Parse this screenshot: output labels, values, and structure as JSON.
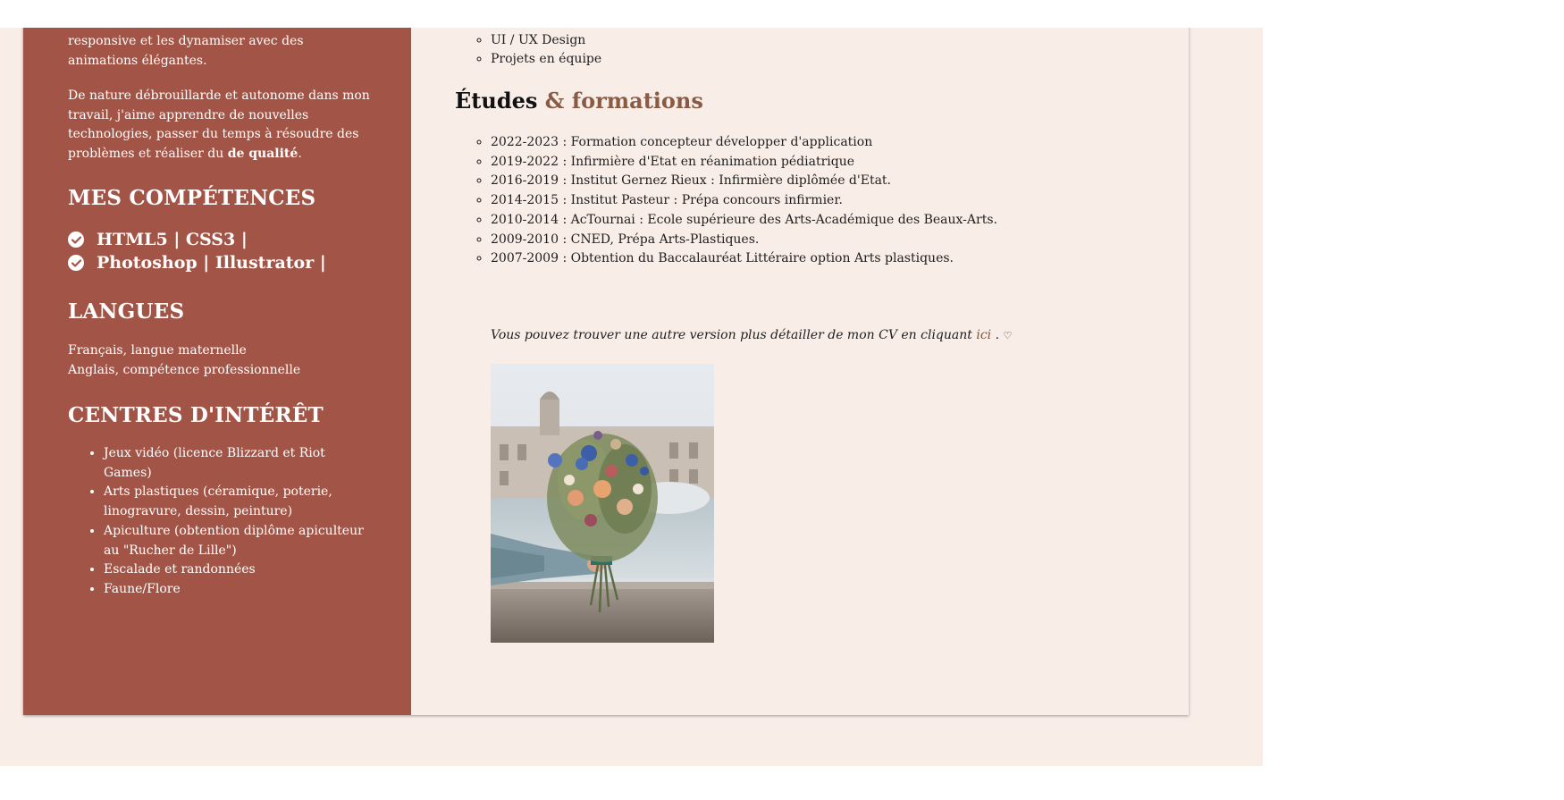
{
  "sidebar": {
    "intro_partial": "responsive et les dynamiser avec des animations élégantes.",
    "intro_p2_start": "De nature débrouillarde et autonome dans mon travail, j'aime apprendre de nouvelles technologies, passer du temps à résoudre des problèmes et réaliser du ",
    "intro_p2_bold": "de qualité",
    "intro_p2_end": ".",
    "skills_title": "MES COMPÉTENCES",
    "skills": [
      "HTML5 | CSS3 |",
      "Photoshop | Illustrator |"
    ],
    "languages_title": "LANGUES",
    "languages": [
      "Français, langue maternelle",
      "Anglais, compétence professionnelle"
    ],
    "interests_title": "CENTRES D'INTÉRÊT",
    "interests": [
      "Jeux vidéo (licence Blizzard et Riot Games)",
      "Arts plastiques (céramique, poterie, linogravure, dessin, peinture)",
      "Apiculture (obtention diplôme apiculteur au \"Rucher de Lille\")",
      "Escalade et randonnées",
      "Faune/Flore"
    ]
  },
  "main": {
    "skills_list": [
      "UI / UX Design",
      "Projets en équipe"
    ],
    "education_title_plain": "Études",
    "education_title_accent": "& formations",
    "education": [
      "2022-2023 : Formation concepteur développer d'application",
      "2019-2022 : Infirmière d'Etat en réanimation pédiatrique",
      "2016-2019 : Institut Gernez Rieux : Infirmière diplômée d'Etat.",
      "2014-2015 : Institut Pasteur : Prépa concours infirmier.",
      "2010-2014 : AcTournai : Ecole supérieure des Arts-Académique des Beaux-Arts.",
      "2009-2010 : CNED, Prépa Arts-Plastiques.",
      "2007-2009 : Obtention du Baccalauréat Littéraire option Arts plastiques."
    ],
    "cv_note": "Vous pouvez trouver une autre version plus détailler de mon CV en cliquant",
    "cv_link": "ici",
    "cv_note_end": " .",
    "cv_heart": "♡"
  },
  "colors": {
    "sidebar_bg": "#a25546",
    "page_bg": "#f9ede8",
    "accent": "#8a5b44"
  }
}
